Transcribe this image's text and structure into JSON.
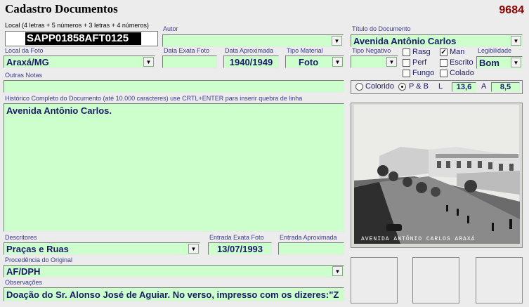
{
  "form_title": "Cadastro Documentos",
  "record_id": "9684",
  "local": {
    "label": "Local (4 letras + 5 números + 3 letras + 4 números)",
    "value": "SAPP01858AFT0125"
  },
  "autor": {
    "label": "Autor",
    "value": ""
  },
  "titulo": {
    "label": "Título do Documento",
    "value": "Avenida Antônio Carlos"
  },
  "local_foto": {
    "label": "Local da Foto",
    "value": "Araxá/MG"
  },
  "data_exata_foto": {
    "label": "Data Exata Foto",
    "value": ""
  },
  "data_aproximada": {
    "label": "Data Aproximada",
    "value": "1940/1949"
  },
  "tipo_material": {
    "label": "Tipo Material",
    "value": "Foto"
  },
  "tipo_negativo": {
    "label": "Tipo Negativo",
    "value": ""
  },
  "checkboxes": [
    {
      "label": "Rasg",
      "checked": false
    },
    {
      "label": "Man",
      "checked": true
    },
    {
      "label": "Perf",
      "checked": false
    },
    {
      "label": "Escrito",
      "checked": false
    },
    {
      "label": "Fungo",
      "checked": false
    },
    {
      "label": "Colado",
      "checked": false
    }
  ],
  "legibilidade": {
    "label": "Legibilidade",
    "value": "Bom"
  },
  "outras_notas": {
    "label": "Outras Notas",
    "value": ""
  },
  "color_mode": {
    "colorido_label": "Colorido",
    "pb_label": "P & B",
    "selected": "P & B"
  },
  "dimensions": {
    "l_label": "L",
    "l_value": "13,6",
    "a_label": "A",
    "a_value": "8,5"
  },
  "historico": {
    "label": "Histórico Completo do Documento (até 10.000 caracteres) use CRTL+ENTER para inserir quebra de linha",
    "value": "Avenida Antônio Carlos."
  },
  "photo_caption": "AVENIDA ANTÔNIO CARLOS   ARAXÁ",
  "descritores": {
    "label": "Descritores",
    "value": "Praças e Ruas"
  },
  "entrada_exata_foto": {
    "label": "Entrada Exata Foto",
    "value": "13/07/1993"
  },
  "entrada_aproximada": {
    "label": "Entrada Aproximada",
    "value": ""
  },
  "procedencia": {
    "label": "Procedência do Original",
    "value": "AF/DPH"
  },
  "observacoes": {
    "label": "Observações",
    "value": "Doação do Sr. Alonso José de Aguiar. No verso, impresso com os dizeres:\"Z"
  },
  "colors": {
    "field_bg": "#ccffcc",
    "label_color": "#3a3a8a",
    "id_color": "#8b0000"
  }
}
